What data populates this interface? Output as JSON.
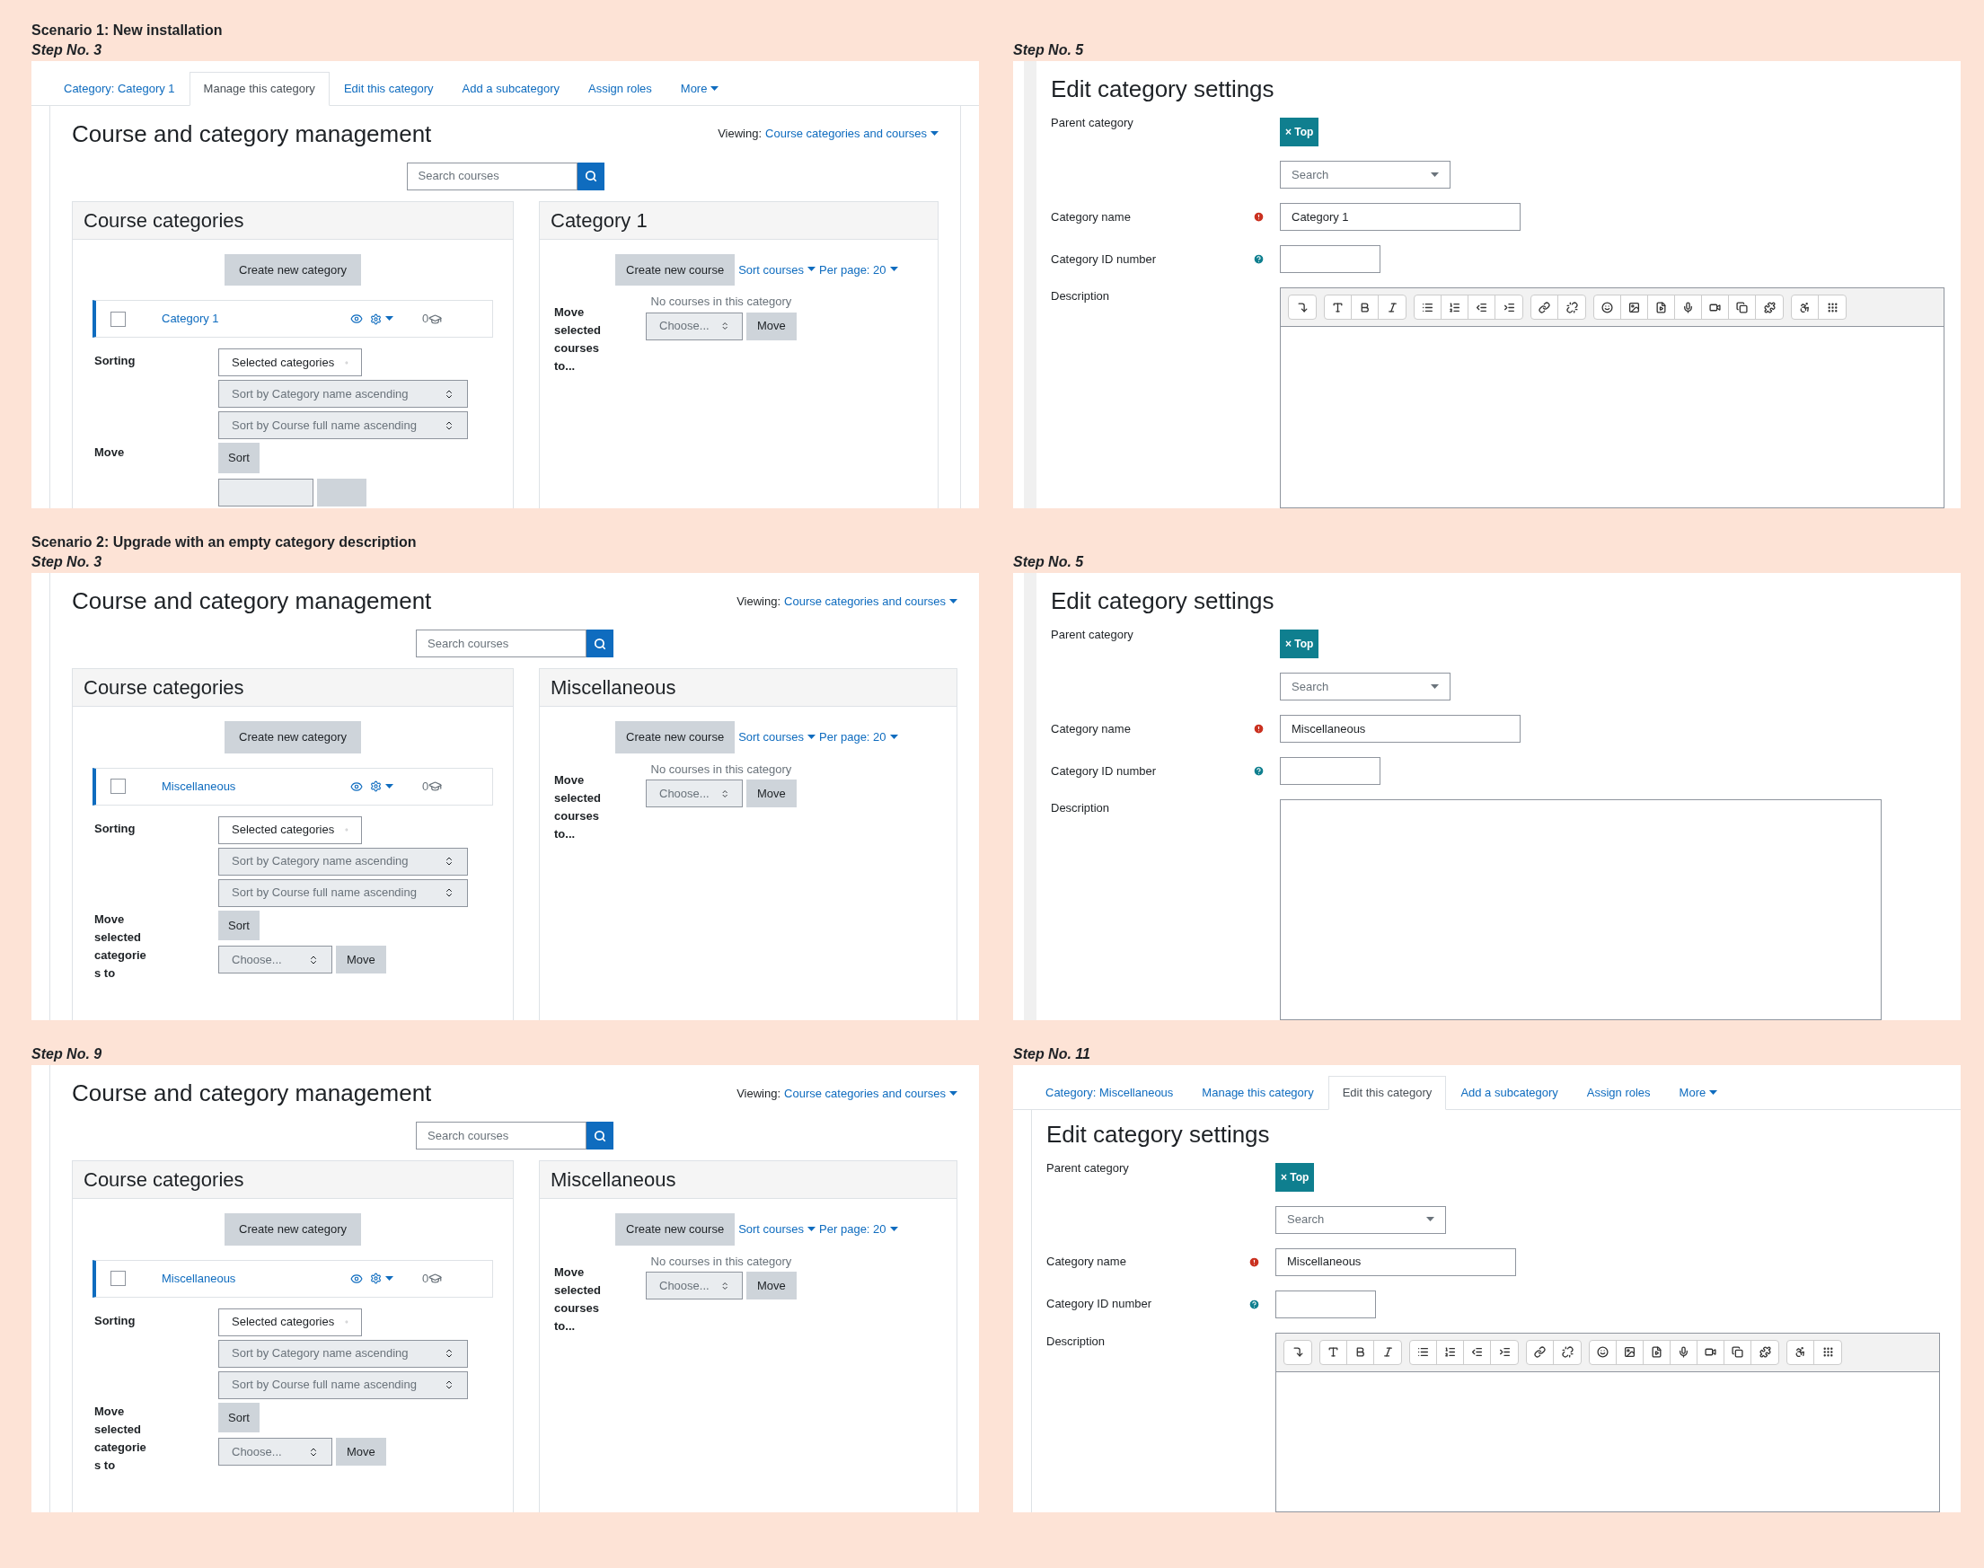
{
  "sections": [
    {
      "heading": "Scenario 1: New installation",
      "panels": [
        {
          "step": "Step No. 3",
          "screen": {
            "kind": "management",
            "tabs": [
              {
                "label": "Category: Category 1",
                "selected": false,
                "menu": false
              },
              {
                "label": "Manage this category",
                "selected": true,
                "menu": false
              },
              {
                "label": "Edit this category",
                "selected": false,
                "menu": false
              },
              {
                "label": "Add a subcategory",
                "selected": false,
                "menu": false
              },
              {
                "label": "Assign roles",
                "selected": false,
                "menu": false
              },
              {
                "label": "More",
                "selected": false,
                "menu": true
              }
            ],
            "title": "Course and category management",
            "viewing_label": "Viewing:",
            "viewing_value": "Course categories and courses",
            "search_placeholder": "Search courses",
            "categories_panel": {
              "title": "Course categories",
              "create_button": "Create new category",
              "items": [
                {
                  "name": "Category 1",
                  "checked": false,
                  "count": "0"
                }
              ],
              "sorting_label": "Sorting",
              "sort_options": [
                "Selected categories",
                "Sort by Category name ascending",
                "Sort by Course full name ascending"
              ],
              "sort_button": "Sort",
              "move_label": "Move"
            },
            "courses_panel": {
              "title": "Category 1",
              "create_button": "Create new course",
              "sort_link": "Sort courses",
              "per_page": "Per page: 20",
              "empty_note": "No courses in this category",
              "move_label": "Move selected courses to...",
              "move_select": "Choose...",
              "move_button": "Move"
            }
          }
        },
        {
          "step": "Step No. 5",
          "screen": {
            "kind": "edit",
            "title": "Edit category settings",
            "parent_label": "Parent category",
            "parent_tag": "× Top",
            "parent_search": "Search",
            "name_label": "Category name",
            "name_value": "Category 1",
            "id_label": "Category ID number",
            "description_label": "Description",
            "editor_toolbar": true
          }
        }
      ]
    },
    {
      "heading": "Scenario 2: Upgrade with an empty category description",
      "panels": [
        {
          "step": "Step No. 3",
          "screen": {
            "kind": "management",
            "title": "Course and category management",
            "viewing_label": "Viewing:",
            "viewing_value": "Course categories and courses",
            "search_placeholder": "Search courses",
            "categories_panel": {
              "title": "Course categories",
              "create_button": "Create new category",
              "items": [
                {
                  "name": "Miscellaneous",
                  "checked": false,
                  "count": "0"
                }
              ],
              "sorting_label": "Sorting",
              "sort_options": [
                "Selected categories",
                "Sort by Category name ascending",
                "Sort by Course full name ascending"
              ],
              "sort_button": "Sort",
              "move_label": "Move selected categories to",
              "move_select": "Choose...",
              "move_button": "Move"
            },
            "courses_panel": {
              "title": "Miscellaneous",
              "create_button": "Create new course",
              "sort_link": "Sort courses",
              "per_page": "Per page: 20",
              "empty_note": "No courses in this category",
              "move_label": "Move selected courses to...",
              "move_select": "Choose...",
              "move_button": "Move"
            }
          }
        },
        {
          "step": "Step No. 5",
          "screen": {
            "kind": "edit",
            "title": "Edit category settings",
            "parent_label": "Parent category",
            "parent_tag": "× Top",
            "parent_search": "Search",
            "name_label": "Category name",
            "name_value": "Miscellaneous",
            "id_label": "Category ID number",
            "description_label": "Description",
            "editor_toolbar": false
          }
        }
      ]
    },
    {
      "panels": [
        {
          "step": "Step No. 9",
          "screen": {
            "kind": "management",
            "title": "Course and category management",
            "viewing_label": "Viewing:",
            "viewing_value": "Course categories and courses",
            "search_placeholder": "Search courses",
            "categories_panel": {
              "title": "Course categories",
              "create_button": "Create new category",
              "items": [
                {
                  "name": "Miscellaneous",
                  "checked": false,
                  "count": "0"
                }
              ],
              "sorting_label": "Sorting",
              "sort_options": [
                "Selected categories",
                "Sort by Category name ascending",
                "Sort by Course full name ascending"
              ],
              "sort_button": "Sort",
              "move_label": "Move selected categories to",
              "move_select": "Choose...",
              "move_button": "Move"
            },
            "courses_panel": {
              "title": "Miscellaneous",
              "create_button": "Create new course",
              "sort_link": "Sort courses",
              "per_page": "Per page: 20",
              "empty_note": "No courses in this category",
              "move_label": "Move selected courses to...",
              "move_select": "Choose...",
              "move_button": "Move"
            }
          }
        },
        {
          "step": "Step No. 11",
          "screen": {
            "kind": "edit",
            "tabs": [
              {
                "label": "Category: Miscellaneous",
                "selected": false,
                "menu": false
              },
              {
                "label": "Manage this category",
                "selected": false,
                "menu": false
              },
              {
                "label": "Edit this category",
                "selected": true,
                "menu": false
              },
              {
                "label": "Add a subcategory",
                "selected": false,
                "menu": false
              },
              {
                "label": "Assign roles",
                "selected": false,
                "menu": false
              },
              {
                "label": "More",
                "selected": false,
                "menu": true
              }
            ],
            "title": "Edit category settings",
            "parent_label": "Parent category",
            "parent_tag": "× Top",
            "parent_search": "Search",
            "name_label": "Category name",
            "name_value": "Miscellaneous",
            "id_label": "Category ID number",
            "description_label": "Description",
            "editor_toolbar": true
          }
        }
      ]
    }
  ]
}
